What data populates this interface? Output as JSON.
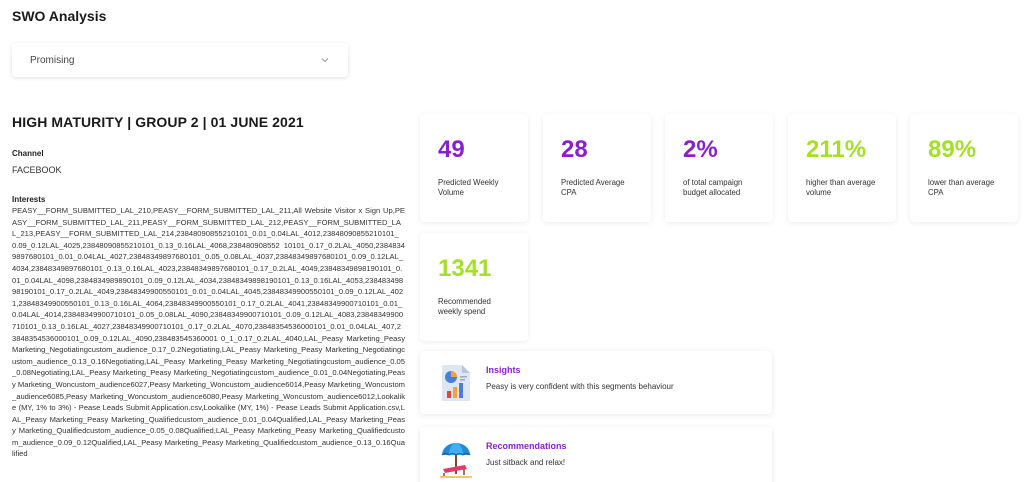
{
  "page": {
    "title": "SWO Analysis"
  },
  "filter": {
    "selected": "Promising"
  },
  "segment": {
    "title": "HIGH MATURITY | GROUP 2 | 01 JUNE 2021",
    "channel_label": "Channel",
    "channel_value": "FACEBOOK",
    "interests_label": "Interests",
    "interests_text": "PEASY__FORM_SUBMITTED_LAL_210,PEASY__FORM_SUBMITTED_LAL_211,All Website Visitor x Sign Up,PEASY__FORM_SUBMITTED_LAL_211,PEASY__FORM_SUBMITTED_LAL_212,PEASY__FORM_SUBMITTED_LAL_213,PEASY__FORM_SUBMITTED_LAL_214,23848090855210101_0.01_0.04LAL_4012,23848090855210101_0.09_0.12LAL_4025,23848090855210101_0.13_0.16LAL_4068,238480908552 10101_0.17_0.2LAL_4050,23848349897680101_0.01_0.04LAL_4027,23848349897680101_0.05_0.08LAL_4037,23848349897680101_0.09_0.12LAL_4034,23848349897680101_0.13_0.16LAL_4023,23848349897680101_0.17_0.2LAL_4049,23848349898190101_0.01_0.04LAL_4098,2384834989890101_0.09_0.12LAL_4034,23848349898190101_0.13_0.16LAL_4053,23848349898190101_0.17_0.2LAL_4049,23848349900550101_0.01_0.04LAL_4045,23848349900550101_0.09_0.12LAL_4021,23848349900550101_0.13_0.16LAL_4064,23848349900550101_0.17_0.2LAL_4041,23848349900710101_0.01_0.04LAL_4014,23848349900710101_0.05_0.08LAL_4090,23848349900710101_0.09_0.12LAL_4083,23848349900710101_0.13_0.16LAL_4027,23848349900710101_0.17_0.2LAL_4070,23848354536000101_0.01_0.04LAL_407,23848354536000101_0.09_0.12LAL_4090,238483545360001 0_1_0.17_0.2LAL_4040,LAL_Peasy Marketing_Peasy Marketing_Negotiatingcustom_audience_0.17_0.2Negotiating,LAL_Peasy Marketing_Peasy Marketing_Negotiatingcustom_audience_0.13_0.16Negotiating,LAL_Peasy Marketing_Peasy Marketing_Negotiatingcustom_audience_0.05_0.08Negotiating,LAL_Peasy Marketing_Peasy Marketing_Negotiatingcustom_audience_0.01_0.04Negotiating,Peasy Marketing_Woncustom_audience6027,Peasy Marketing_Woncustom_audience6014,Peasy Marketing_Woncustom_audience6085,Peasy Marketing_Woncustom_audience6080,Peasy Marketing_Woncustom_audience6012,Lookalike (MY, 1% to 3%) - Pease Leads Submit Application.csv,Lookalike (MY, 1%) - Pease Leads Submit Application.csv,LAL_Peasy Marketing_Peasy Marketing_Qualifiedcustom_audience_0.01_0.04Qualified,LAL_Peasy Marketing_Peasy Marketing_Qualifiedcustom_audience_0.05_0.08Qualified,LAL_Peasy Marketing_Peasy Marketing_Qualifiedcustom_audience_0.09_0.12Qualified,LAL_Peasy Marketing_Peasy Marketing_Qualifiedcustom_audience_0.13_0.16Qualified"
  },
  "stats": [
    {
      "value": "49",
      "label": "Predicted Weekly Volume",
      "color": "#8a1fd1"
    },
    {
      "value": "28",
      "label": "Predicted Average CPA",
      "color": "#8a1fd1"
    },
    {
      "value": "2%",
      "label": "of total campaign budget allocated",
      "color": "#8a1fd1"
    },
    {
      "value": "211%",
      "label": "higher than average volume",
      "color": "#a3e027"
    },
    {
      "value": "89%",
      "label": "lower than average CPA",
      "color": "#a3e027"
    },
    {
      "value": "1341",
      "label": "Recommended weekly spend",
      "color": "#a3e027"
    }
  ],
  "insights": {
    "title": "Insights",
    "text": "Peasy is very confident with this segments behaviour",
    "icon": "report-chart-icon"
  },
  "recommendations": {
    "title": "Recommendations",
    "text": "Just sitback and relax!",
    "icon": "beach-umbrella-icon"
  }
}
